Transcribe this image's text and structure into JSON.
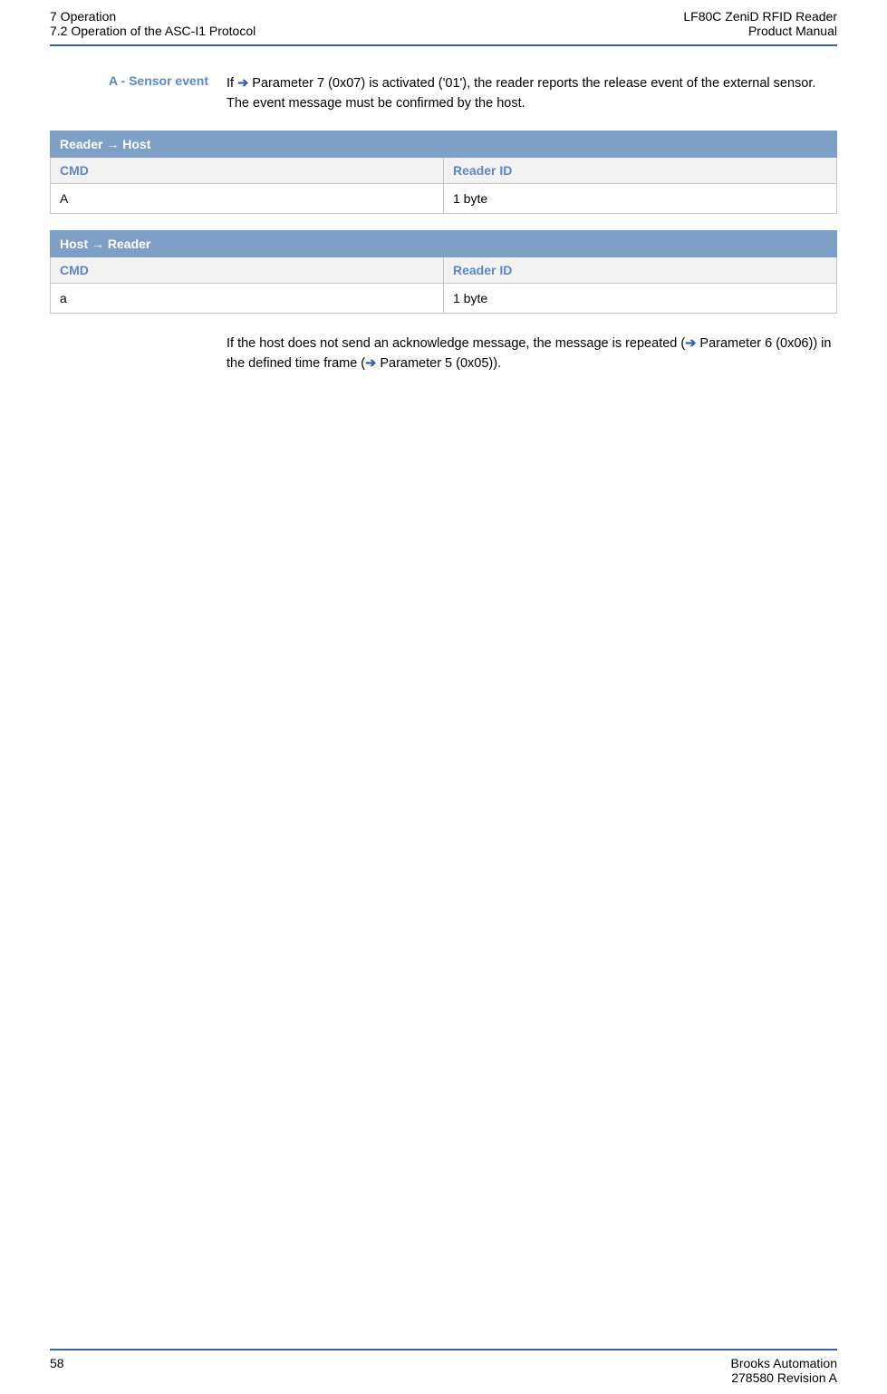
{
  "header": {
    "left_line1": "7 Operation",
    "left_line2": "7.2 Operation of the ASC-I1 Protocol",
    "right_line1": "LF80C ZeniD RFID Reader",
    "right_line2": "Product Manual"
  },
  "section": {
    "side_label": "A - Sensor event",
    "intro_part1": "If ",
    "intro_param7": "Parameter 7 (0x07)",
    "intro_part2": " is activated ('01'), the reader reports the release event of the external sensor. The event message must be confirmed by the host."
  },
  "table1": {
    "banner": "Reader → Host",
    "col1": "CMD",
    "col2": "Reader ID",
    "row": {
      "cmd": "A",
      "rid": "1 byte"
    }
  },
  "table2": {
    "banner": "Host  → Reader",
    "col1": "CMD",
    "col2": "Reader ID",
    "row": {
      "cmd": "a",
      "rid": "1 byte"
    }
  },
  "after": {
    "part1": "If the host does not send an acknowledge message, the message is repeated (",
    "param6": "Parameter 6 (0x06)",
    "part2": ") in the defined time frame (",
    "param5": "Parameter 5 (0x05)",
    "part3": ")."
  },
  "footer": {
    "page": "58",
    "right_line1": "Brooks Automation",
    "right_line2": "278580 Revision A"
  },
  "glyphs": {
    "arrow": "➔"
  }
}
